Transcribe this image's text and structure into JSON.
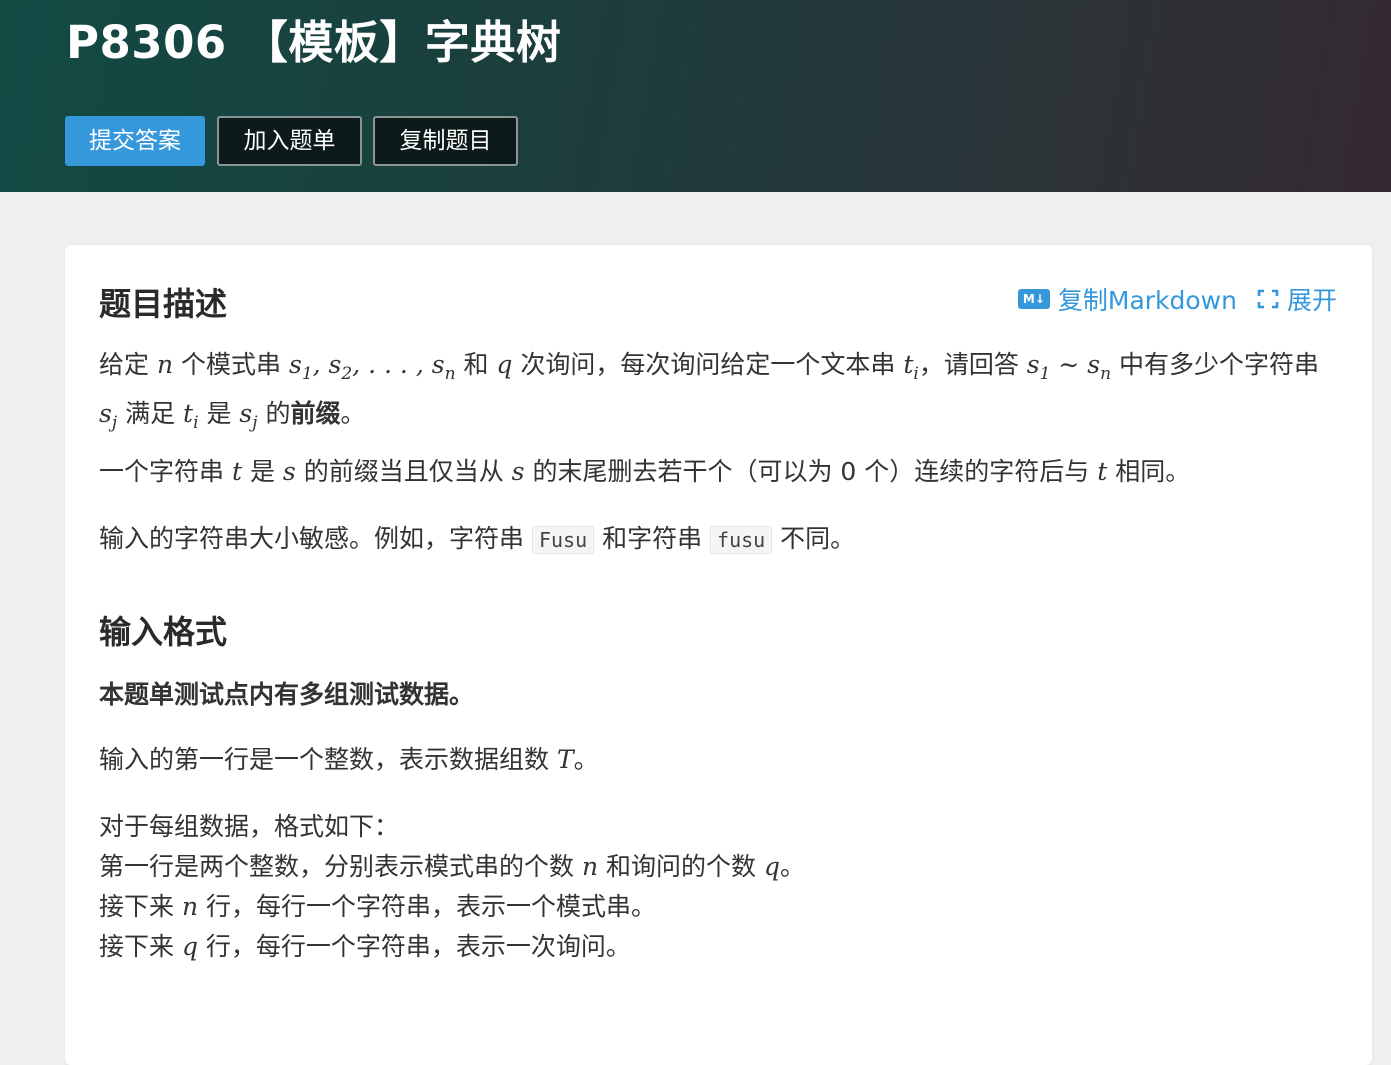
{
  "problem": {
    "title": "P8306 【模板】字典树"
  },
  "header_buttons": {
    "submit": "提交答案",
    "add_to_list": "加入题单",
    "copy_problem": "复制题目"
  },
  "card_actions": {
    "md_badge": "M↓",
    "copy_markdown": "复制Markdown",
    "expand": "展开"
  },
  "description": {
    "heading": "题目描述",
    "p1": {
      "t1": "给定 ",
      "t2": " 个模式串 ",
      "t3": " 和 ",
      "t4": " 次询问，每次询问给定一个文本串 ",
      "t5": "，请回答 ",
      "t6": " 中有多少个字符串 ",
      "t7": " 满足 ",
      "t8": " 是 ",
      "t9": " 的",
      "t10": "前缀",
      "t11": "。"
    },
    "p2": {
      "t1": "一个字符串 ",
      "t2": " 是 ",
      "t3": " 的前缀当且仅当从 ",
      "t4": " 的末尾删去若干个（可以为 0 个）连续的字符后与 ",
      "t5": " 相同。"
    },
    "p3": {
      "t1": "输入的字符串大小敏感。例如，字符串 ",
      "code1": "Fusu",
      "t2": " 和字符串 ",
      "code2": "fusu",
      "t3": " 不同。"
    }
  },
  "input_format": {
    "heading": "输入格式",
    "bold_line": "本题单测试点内有多组测试数据。",
    "line_T": {
      "t1": "输入的第一行是一个整数，表示数据组数 ",
      "t2": "。"
    },
    "lines": {
      "l1": "对于每组数据，格式如下：",
      "l2a": "第一行是两个整数，分别表示模式串的个数 ",
      "l2b": " 和询问的个数 ",
      "l2c": "。",
      "l3a": "接下来 ",
      "l3b": " 行，每行一个字符串，表示一个模式串。",
      "l4a": "接下来 ",
      "l4b": " 行，每行一个字符串，表示一次询问。"
    }
  },
  "math": {
    "n": "n",
    "q": "q",
    "s": "s",
    "t": "t",
    "T": "T",
    "sub_1": "1",
    "sub_2": "2",
    "sub_n": "n",
    "sub_i": "i",
    "sub_j": "j",
    "comma": ", ",
    "ellipsis": ". . . ",
    "tilde": " ∼ "
  }
}
